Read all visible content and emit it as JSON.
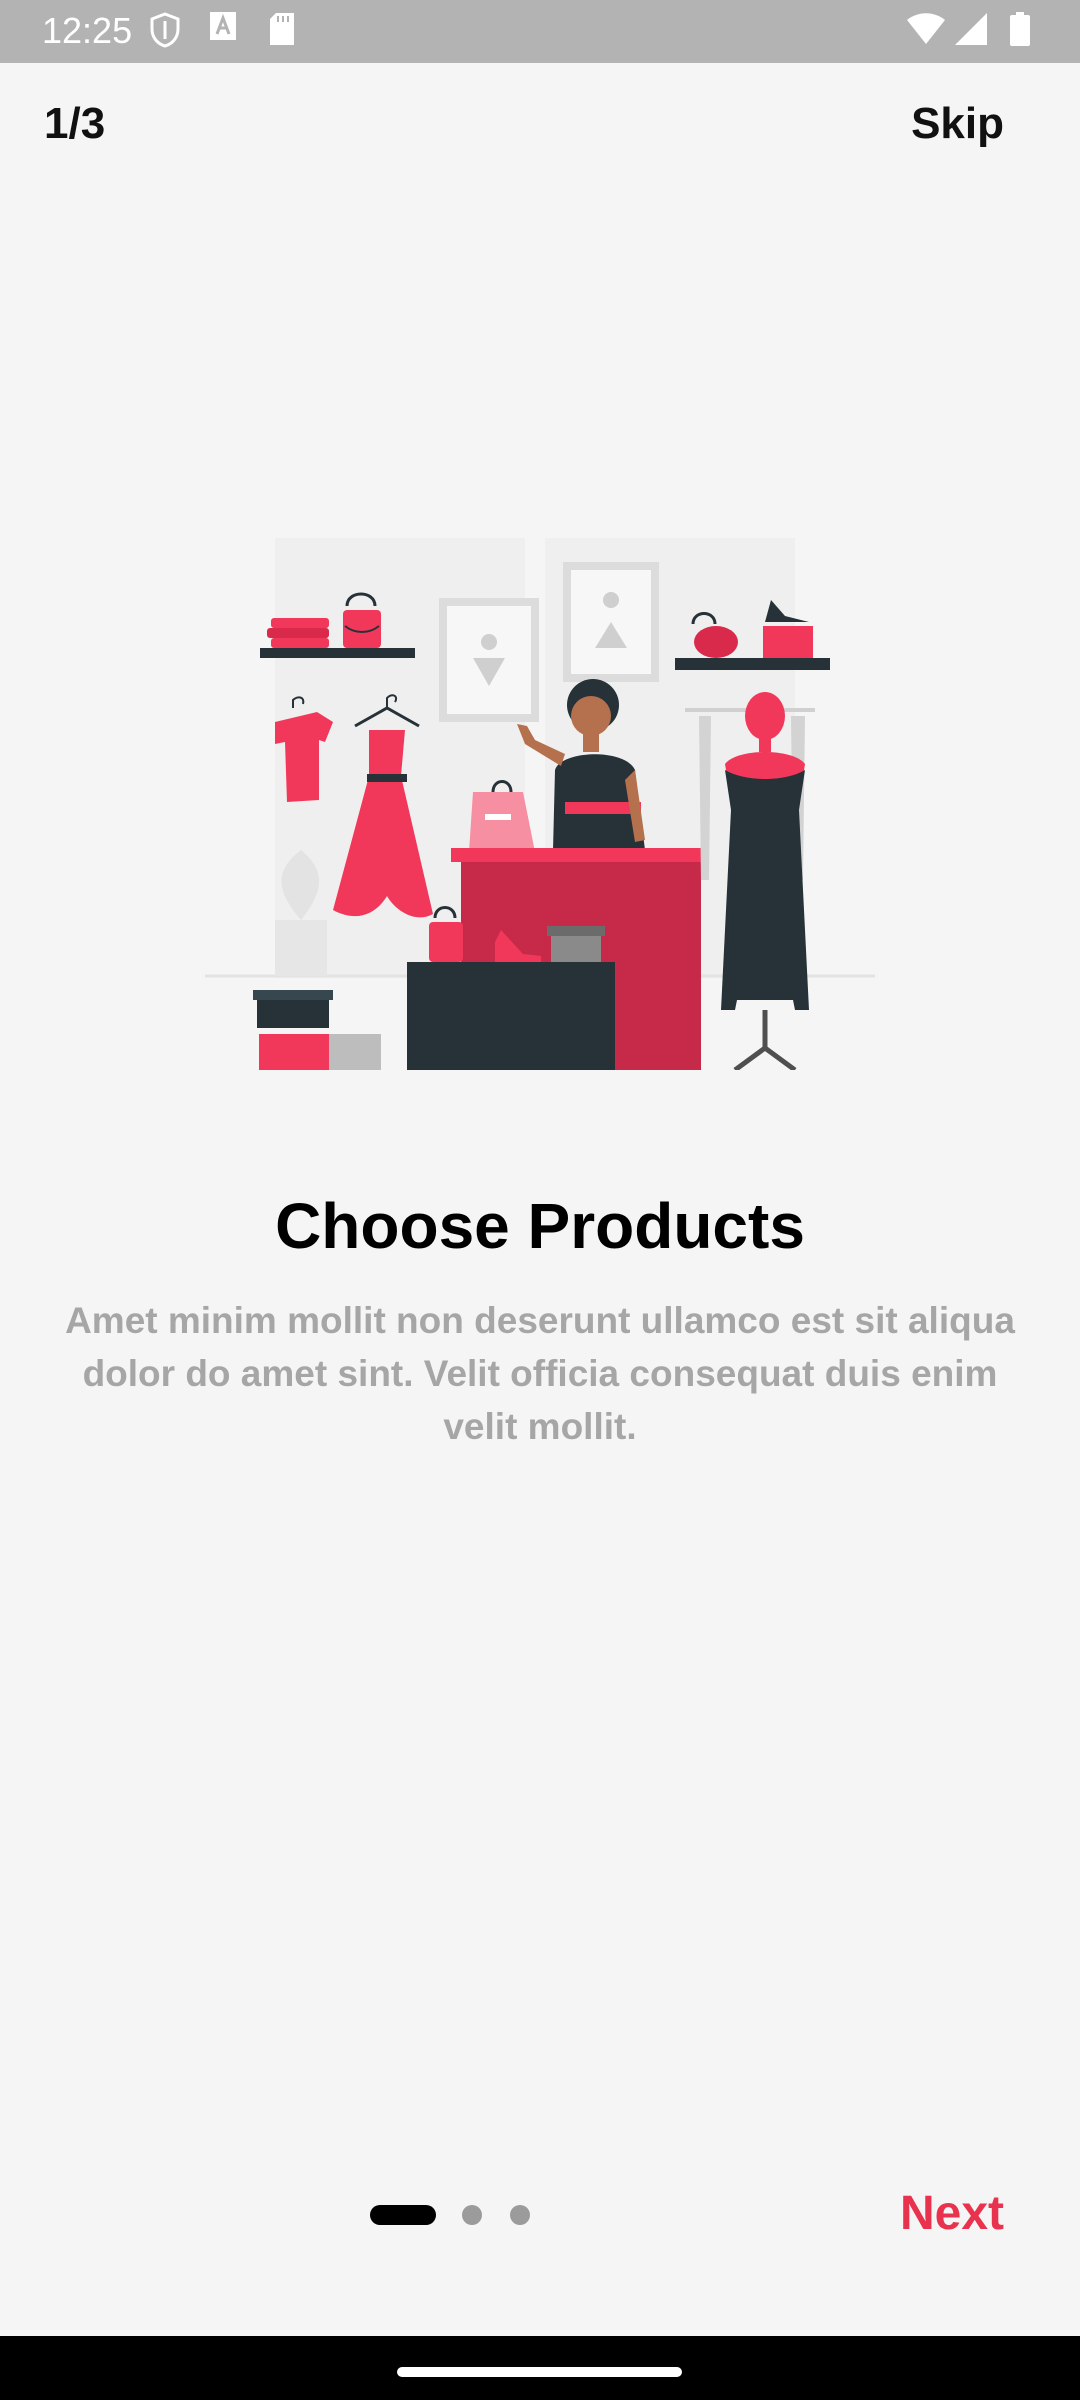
{
  "status_bar": {
    "time": "12:25",
    "left_icons": [
      "shield-icon",
      "text-a-icon",
      "sd-card-icon"
    ],
    "right_icons": [
      "wifi-icon",
      "signal-icon",
      "battery-icon"
    ]
  },
  "header": {
    "counter": "1/3",
    "skip_label": "Skip"
  },
  "illustration": {
    "name": "shop-illustration",
    "accent_color": "#f2385a",
    "dark_color": "#263238"
  },
  "content": {
    "title": "Choose Products",
    "description": "Amet minim mollit non deserunt ullamco est sit aliqua dolor do amet sint. Velit officia consequat duis enim velit mollit."
  },
  "pager": {
    "total": 3,
    "current": 1
  },
  "footer": {
    "next_label": "Next",
    "next_color": "#e8324e"
  }
}
